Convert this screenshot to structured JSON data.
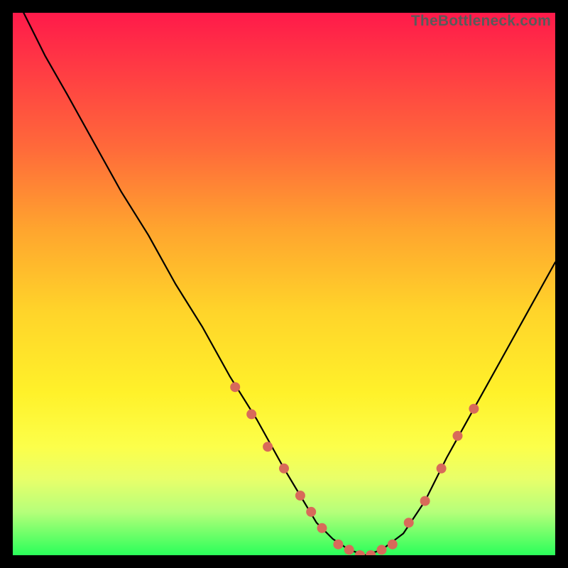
{
  "watermark": "TheBottleneck.com",
  "chart_data": {
    "type": "line",
    "title": "",
    "xlabel": "",
    "ylabel": "",
    "xlim": [
      0,
      100
    ],
    "ylim": [
      0,
      100
    ],
    "grid": false,
    "legend": false,
    "series": [
      {
        "name": "curve",
        "x": [
          2,
          4,
          6,
          10,
          15,
          20,
          25,
          30,
          35,
          40,
          45,
          50,
          53,
          56,
          59,
          62,
          65,
          68,
          72,
          76,
          80,
          85,
          90,
          95,
          100
        ],
        "y": [
          100,
          96,
          92,
          85,
          76,
          67,
          59,
          50,
          42,
          33,
          25,
          16,
          11,
          6,
          3,
          1,
          0,
          1,
          4,
          10,
          18,
          27,
          36,
          45,
          54
        ]
      }
    ],
    "markers": {
      "name": "highlight-dots",
      "color": "#d86a5a",
      "x": [
        41,
        44,
        47,
        50,
        53,
        55,
        57,
        60,
        62,
        64,
        66,
        68,
        70,
        73,
        76,
        79,
        82,
        85
      ],
      "y": [
        31,
        26,
        20,
        16,
        11,
        8,
        5,
        2,
        1,
        0,
        0,
        1,
        2,
        6,
        10,
        16,
        22,
        27
      ]
    }
  }
}
